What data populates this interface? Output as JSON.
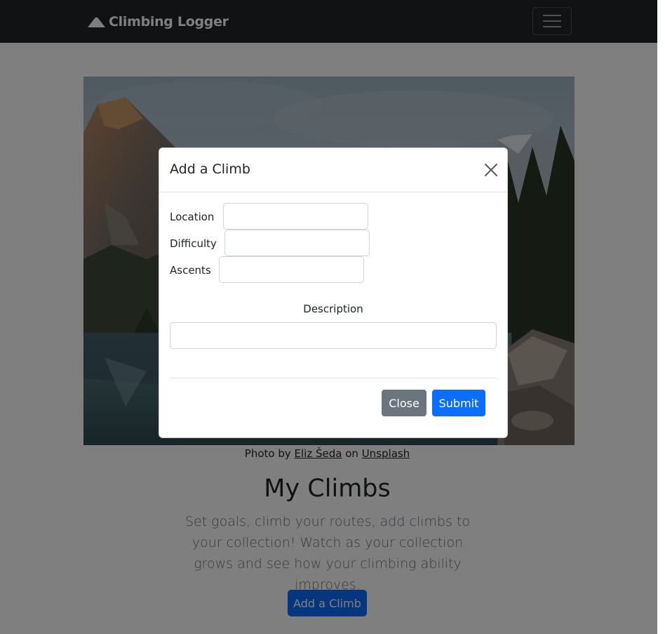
{
  "navbar": {
    "brand_label": "Climbing Logger",
    "brand_icon": "mountain-icon",
    "toggler_icon": "hamburger-icon"
  },
  "hero": {
    "credit_prefix": "Photo by",
    "credit_author": "Eliz Šeda",
    "credit_mid": "on",
    "credit_site": "Unsplash"
  },
  "main": {
    "heading": "My Climbs",
    "lead": "Set goals, climb your routes, add climbs to your collection! Watch as your collection grows and see how your climbing ability improves.",
    "add_button": "Add a Climb"
  },
  "modal": {
    "title": "Add a Climb",
    "close_icon": "close-icon",
    "fields": {
      "location_label": "Location",
      "location_value": "",
      "difficulty_label": "Difficulty",
      "difficulty_value": "",
      "ascents_label": "Ascents",
      "ascents_value": "",
      "description_label": "Description",
      "description_value": ""
    },
    "close_button": "Close",
    "submit_button": "Submit"
  },
  "colors": {
    "navbar_bg": "#212529",
    "primary": "#0d6efd",
    "secondary": "#6c757d"
  }
}
